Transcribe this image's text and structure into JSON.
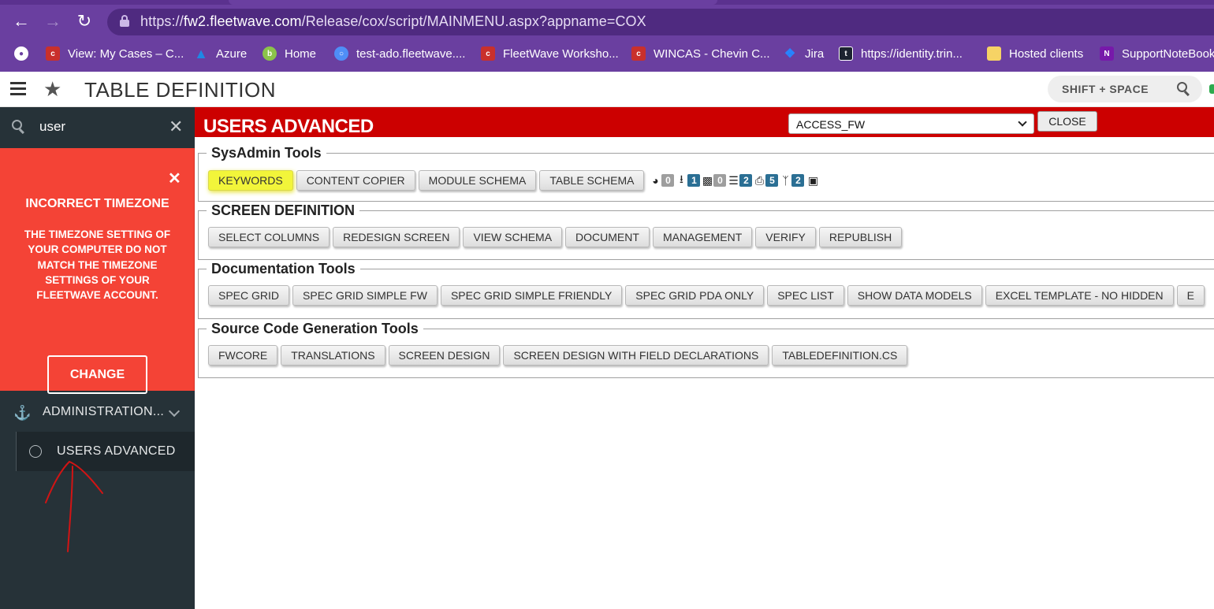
{
  "browser": {
    "url_prefix": "https://",
    "url_host": "fw2.fleetwave.com",
    "url_path": "/Release/cox/script/MAINMENU.aspx?appname=COX",
    "bookmarks": [
      {
        "label": "View: My Cases – C...",
        "icon": "chevin-icon",
        "color": "#c9302c"
      },
      {
        "label": "Azure",
        "icon": "azure-icon",
        "color": "#1e88e5"
      },
      {
        "label": "Home",
        "icon": "home-bookmark-icon",
        "color": "#8bc34a"
      },
      {
        "label": "test-ado.fleetwave....",
        "icon": "globe-icon",
        "color": "#4f8ef7"
      },
      {
        "label": "FleetWave Worksho...",
        "icon": "chevin-icon",
        "color": "#c9302c"
      },
      {
        "label": "WINCAS - Chevin C...",
        "icon": "chevin-icon",
        "color": "#c9302c"
      },
      {
        "label": "Jira",
        "icon": "jira-icon",
        "color": "#2684ff"
      },
      {
        "label": "https://identity.trin...",
        "icon": "t-icon",
        "color": "#1c2330"
      },
      {
        "label": "Hosted clients",
        "icon": "folder-icon",
        "color": "#f6d365"
      },
      {
        "label": "SupportNoteBook",
        "icon": "onenote-icon",
        "color": "#7719aa"
      }
    ]
  },
  "header": {
    "title": "TABLE DEFINITION",
    "shortcut": "SHIFT + SPACE"
  },
  "sidebar": {
    "search_value": "user",
    "alert": {
      "title": "INCORRECT TIMEZONE",
      "message": "THE TIMEZONE SETTING OF YOUR COMPUTER DO NOT MATCH THE TIMEZONE SETTINGS OF YOUR FLEETWAVE ACCOUNT.",
      "button": "CHANGE"
    },
    "group_label": "ADMINISTRATION...",
    "item_label": "USERS ADVANCED"
  },
  "main": {
    "title": "USERS ADVANCED",
    "select_value": "ACCESS_FW",
    "close_label": "CLOSE",
    "sections": {
      "sysadmin": {
        "legend": "SysAdmin Tools",
        "buttons": [
          "KEYWORDS",
          "CONTENT COPIER",
          "MODULE SCHEMA",
          "TABLE SCHEMA"
        ]
      },
      "screen": {
        "legend": "SCREEN DEFINITION",
        "buttons": [
          "SELECT COLUMNS",
          "REDESIGN SCREEN",
          "VIEW SCHEMA",
          "DOCUMENT",
          "MANAGEMENT",
          "VERIFY",
          "REPUBLISH"
        ]
      },
      "docs": {
        "legend": "Documentation Tools",
        "buttons": [
          "SPEC GRID",
          "SPEC GRID SIMPLE FW",
          "SPEC GRID SIMPLE FRIENDLY",
          "SPEC GRID PDA ONLY",
          "SPEC LIST",
          "SHOW DATA MODELS",
          "EXCEL TEMPLATE - NO HIDDEN",
          "E"
        ]
      },
      "source": {
        "legend": "Source Code Generation Tools",
        "buttons": [
          "FWCORE",
          "TRANSLATIONS",
          "SCREEN DESIGN",
          "SCREEN DESIGN WITH FIELD DECLARATIONS",
          "TABLEDEFINITION.CS"
        ]
      }
    },
    "badges": [
      {
        "icon": "pie-chart-icon",
        "count": "0",
        "style": "grey"
      },
      {
        "icon": "upload-icon",
        "count": "1",
        "style": "blue"
      },
      {
        "icon": "calendar-icon",
        "count": "0",
        "style": "grey"
      },
      {
        "icon": "checklist-icon",
        "count": "2",
        "style": "blue"
      },
      {
        "icon": "print-icon",
        "count": "5",
        "style": "blue"
      },
      {
        "icon": "branch-icon",
        "count": "2",
        "style": "blue"
      }
    ],
    "highlight_color": "#f2f53a"
  }
}
